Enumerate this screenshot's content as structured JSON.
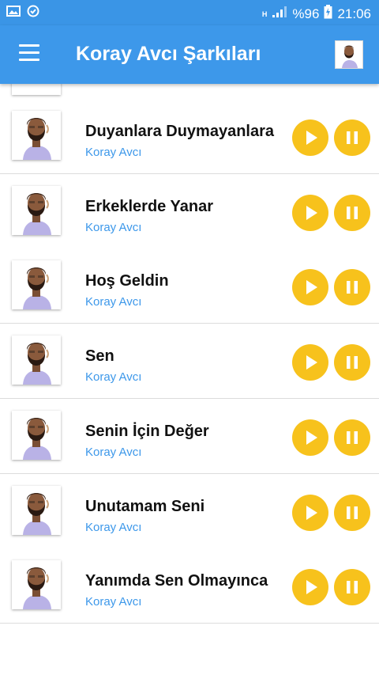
{
  "status_bar": {
    "network": "H",
    "battery": "%96",
    "time": "21:06"
  },
  "app_bar": {
    "title": "Koray Avcı Şarkıları"
  },
  "songs": [
    {
      "title": "Duyanlara Duymayanlara",
      "artist": "Koray Avcı"
    },
    {
      "title": "Erkeklerde Yanar",
      "artist": "Koray Avcı"
    },
    {
      "title": "Hoş Geldin",
      "artist": "Koray Avcı"
    },
    {
      "title": "Sen",
      "artist": "Koray Avcı"
    },
    {
      "title": "Senin İçin Değer",
      "artist": "Koray Avcı"
    },
    {
      "title": "Unutamam Seni",
      "artist": "Koray Avcı"
    },
    {
      "title": "Yanımda Sen Olmayınca",
      "artist": "Koray Avcı"
    }
  ],
  "colors": {
    "primary": "#3d98ea",
    "accent": "#f7c21c"
  },
  "icons": [
    "image-icon",
    "check-circle-icon",
    "signal-icon",
    "battery-icon",
    "menu-icon",
    "play-icon",
    "pause-icon"
  ]
}
